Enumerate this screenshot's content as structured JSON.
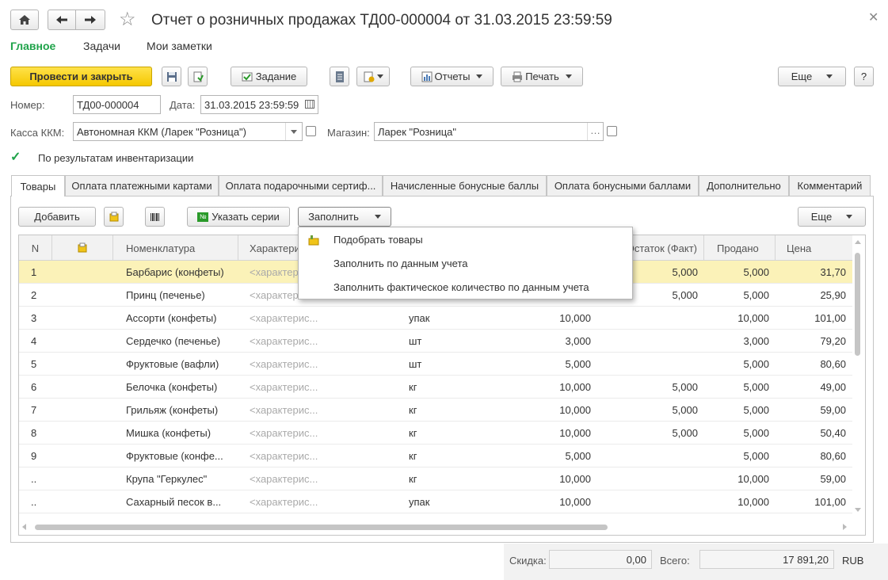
{
  "window": {
    "title": "Отчет о розничных продажах ТД00-000004 от 31.03.2015 23:59:59"
  },
  "nav": {
    "items": [
      "Главное",
      "Задачи",
      "Мои заметки"
    ]
  },
  "toolbar": {
    "post_close": "Провести и закрыть",
    "task": "Задание",
    "reports": "Отчеты",
    "print": "Печать",
    "more": "Еще",
    "help": "?"
  },
  "form": {
    "number_label": "Номер:",
    "number_value": "ТД00-000004",
    "date_label": "Дата:",
    "date_value": "31.03.2015 23:59:59",
    "cash_label": "Касса ККМ:",
    "cash_value": "Автономная ККМ (Ларек \"Розница\")",
    "store_label": "Магазин:",
    "store_value": "Ларек \"Розница\"",
    "inventory_label": "По результатам инвентаризации",
    "inventory_checked": true
  },
  "tabs": [
    "Товары",
    "Оплата платежными картами",
    "Оплата подарочными сертиф...",
    "Начисленные бонусные баллы",
    "Оплата бонусными баллами",
    "Дополнительно",
    "Комментарий"
  ],
  "table_toolbar": {
    "add": "Добавить",
    "series": "Указать серии",
    "fill": "Заполнить",
    "more": "Еще"
  },
  "fill_menu": [
    "Подобрать товары",
    "Заполнить по данным учета",
    "Заполнить фактическое количество по данным учета"
  ],
  "table": {
    "columns": [
      "N",
      "Номенклатура",
      "Характеристика",
      "Остаток (Факт)",
      "Продано",
      "Цена"
    ],
    "char_placeholder": "<характерис...",
    "rows": [
      {
        "n": "1",
        "item": "Барбарис (конфеты)",
        "unit": "",
        "qty": "",
        "fact": "5,000",
        "sold": "5,000",
        "price": "31,70"
      },
      {
        "n": "2",
        "item": "Принц (печенье)",
        "unit": "",
        "qty": "",
        "fact": "5,000",
        "sold": "5,000",
        "price": "25,90"
      },
      {
        "n": "3",
        "item": "Ассорти (конфеты)",
        "unit": "упак",
        "qty": "10,000",
        "fact": "",
        "sold": "10,000",
        "price": "101,00"
      },
      {
        "n": "4",
        "item": "Сердечко (печенье)",
        "unit": "шт",
        "qty": "3,000",
        "fact": "",
        "sold": "3,000",
        "price": "79,20"
      },
      {
        "n": "5",
        "item": "Фруктовые (вафли)",
        "unit": "шт",
        "qty": "5,000",
        "fact": "",
        "sold": "5,000",
        "price": "80,60"
      },
      {
        "n": "6",
        "item": "Белочка (конфеты)",
        "unit": "кг",
        "qty": "10,000",
        "fact": "5,000",
        "sold": "5,000",
        "price": "49,00"
      },
      {
        "n": "7",
        "item": "Грильяж (конфеты)",
        "unit": "кг",
        "qty": "10,000",
        "fact": "5,000",
        "sold": "5,000",
        "price": "59,00"
      },
      {
        "n": "8",
        "item": "Мишка (конфеты)",
        "unit": "кг",
        "qty": "10,000",
        "fact": "5,000",
        "sold": "5,000",
        "price": "50,40"
      },
      {
        "n": "9",
        "item": "Фруктовые (конфе...",
        "unit": "кг",
        "qty": "5,000",
        "fact": "",
        "sold": "5,000",
        "price": "80,60"
      },
      {
        "n": "..",
        "item": "Крупа \"Геркулес\"",
        "unit": "кг",
        "qty": "10,000",
        "fact": "",
        "sold": "10,000",
        "price": "59,00"
      },
      {
        "n": "..",
        "item": "Сахарный песок в...",
        "unit": "упак",
        "qty": "10,000",
        "fact": "",
        "sold": "10,000",
        "price": "101,00"
      }
    ]
  },
  "footer": {
    "discount_label": "Скидка:",
    "discount_value": "0,00",
    "total_label": "Всего:",
    "total_value": "17 891,20",
    "currency": "RUB"
  },
  "colors": {
    "accent": "#1fa34a",
    "primary_button": "#f5c800",
    "selected_row": "#fbf2b8"
  }
}
